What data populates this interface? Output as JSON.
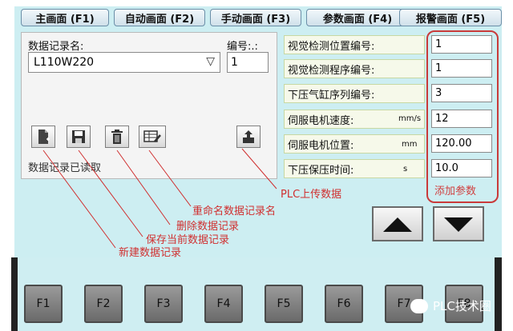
{
  "tabs": [
    {
      "label": "主画面 (F1)"
    },
    {
      "label": "自动画面 (F2)"
    },
    {
      "label": "手动画面 (F3)"
    },
    {
      "label": "参数画面 (F4)"
    },
    {
      "label": "报警画面 (F5)"
    }
  ],
  "record_panel": {
    "name_label": "数据记录名:",
    "number_label": "编号:.:",
    "selected_record": "L110W220",
    "number_value": "1",
    "status_text": "数据记录已读取"
  },
  "params": [
    {
      "label": "视觉检测位置编号:",
      "unit": "",
      "value": "1"
    },
    {
      "label": "视觉检测程序编号:",
      "unit": "",
      "value": "1"
    },
    {
      "label": "下压气缸序列编号:",
      "unit": "",
      "value": "3"
    },
    {
      "label": "伺服电机速度:",
      "unit": "mm/s",
      "value": "12"
    },
    {
      "label": "伺服电机位置:",
      "unit": "mm",
      "value": "120.00"
    },
    {
      "label": "下压保压时间:",
      "unit": "s",
      "value": "10.0"
    }
  ],
  "annotations": {
    "add_param": "添加参数",
    "plc_upload": "PLC上传数据",
    "rename": "重命名数据记录名",
    "delete": "删除数据记录",
    "save": "保存当前数据记录",
    "new": "新建数据记录"
  },
  "function_keys": [
    "F1",
    "F2",
    "F3",
    "F4",
    "F5",
    "F6",
    "F7",
    "F8"
  ],
  "watermark": "PLC技术圈",
  "colors": {
    "accent_red": "#d03030",
    "hmi_background": "#cdeef2"
  }
}
